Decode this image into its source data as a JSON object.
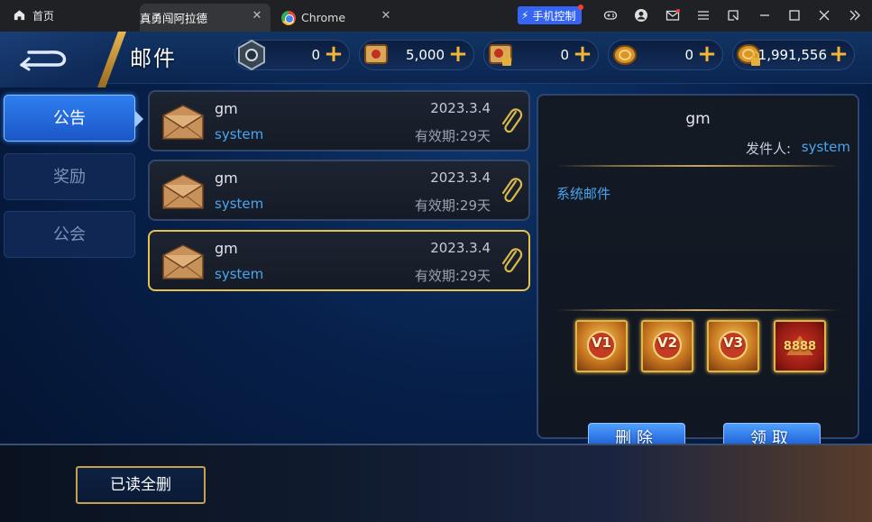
{
  "browser": {
    "home_label": "首页",
    "tabs": [
      {
        "label": "真勇闯阿拉德",
        "active": true
      },
      {
        "label": "Chrome",
        "active": false
      }
    ],
    "phone_control_label": "手机控制"
  },
  "game": {
    "title": "邮件",
    "resources": [
      {
        "icon": "emblem-icon",
        "value": "0"
      },
      {
        "icon": "scroll-icon",
        "value": "5,000"
      },
      {
        "icon": "locked-scroll-icon",
        "value": "0"
      },
      {
        "icon": "gold-coin-icon",
        "value": "0"
      },
      {
        "icon": "locked-coin-icon",
        "value": "1,991,556"
      }
    ],
    "side_tabs": [
      {
        "label": "公告",
        "active": true
      },
      {
        "label": "奖励",
        "active": false
      },
      {
        "label": "公会",
        "active": false
      }
    ],
    "mails": [
      {
        "sender": "gm",
        "from": "system",
        "date": "2023.3.4",
        "expiry": "有效期:29天",
        "selected": false
      },
      {
        "sender": "gm",
        "from": "system",
        "date": "2023.3.4",
        "expiry": "有效期:29天",
        "selected": false
      },
      {
        "sender": "gm",
        "from": "system",
        "date": "2023.3.4",
        "expiry": "有效期:29天",
        "selected": true
      }
    ],
    "detail": {
      "title": "gm",
      "sender_label": "发件人:",
      "sender": "system",
      "body": "系统邮件",
      "rewards": [
        "V1",
        "V2",
        "V3",
        "8888"
      ],
      "delete_label": "删除",
      "claim_label": "领取"
    },
    "read_delete_label": "已读全删"
  }
}
